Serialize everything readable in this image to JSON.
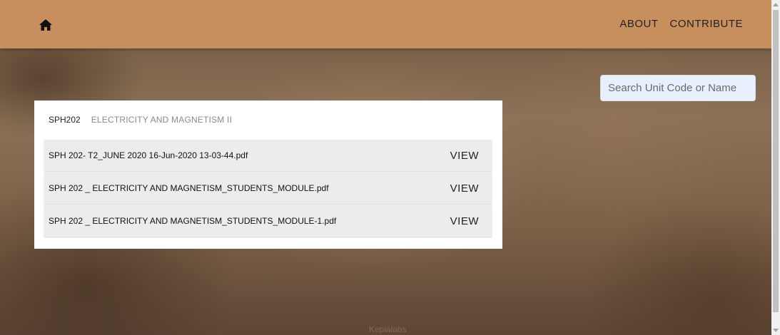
{
  "nav": {
    "home_icon": "home-icon",
    "links": [
      "ABOUT",
      "CONTRIBUTE"
    ],
    "background": "#c88f5e"
  },
  "search": {
    "placeholder": "Search Unit Code or Name",
    "value": ""
  },
  "unit": {
    "code": "SPH202",
    "name": "ELECTRICITY AND MAGNETISM II"
  },
  "files": [
    {
      "name": "SPH 202- T2_JUNE 2020 16-Jun-2020 13-03-44.pdf",
      "action": "VIEW"
    },
    {
      "name": "SPH 202 _ ELECTRICITY AND MAGNETISM_STUDENTS_MODULE.pdf",
      "action": "VIEW"
    },
    {
      "name": "SPH 202 _ ELECTRICITY AND MAGNETISM_STUDENTS_MODULE-1.pdf",
      "action": "VIEW"
    }
  ],
  "footer": {
    "text": "Kepialabs"
  }
}
